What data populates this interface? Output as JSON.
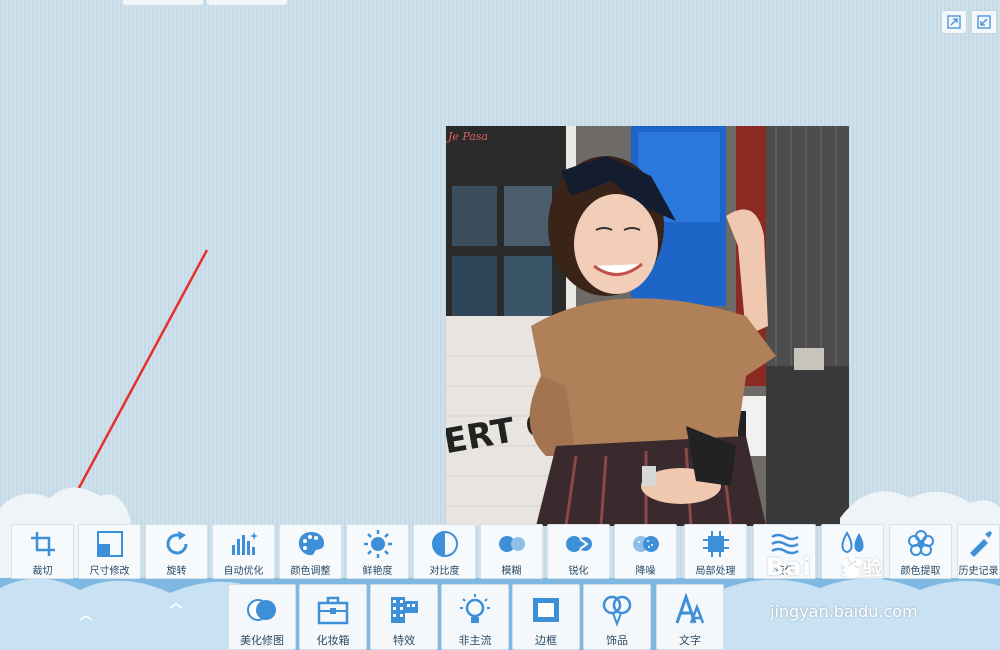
{
  "toolbar_primary": [
    {
      "label": "裁切",
      "icon": "crop-icon"
    },
    {
      "label": "尺寸修改",
      "icon": "resize-icon"
    },
    {
      "label": "旋转",
      "icon": "rotate-icon"
    },
    {
      "label": "自动优化",
      "icon": "auto-enhance-icon"
    },
    {
      "label": "颜色调整",
      "icon": "palette-icon"
    },
    {
      "label": "鲜艳度",
      "icon": "sun-icon"
    },
    {
      "label": "对比度",
      "icon": "contrast-icon"
    },
    {
      "label": "模糊",
      "icon": "blur-icon"
    },
    {
      "label": "锐化",
      "icon": "sharpen-icon"
    },
    {
      "label": "降噪",
      "icon": "denoise-icon"
    },
    {
      "label": "局部处理",
      "icon": "local-process-icon"
    },
    {
      "label": "液化",
      "icon": "liquify-icon"
    },
    {
      "label": "",
      "icon": "drops-icon"
    },
    {
      "label": "颜色提取",
      "icon": "flower-icon"
    },
    {
      "label": "历史记录",
      "icon": "history-icon"
    }
  ],
  "toolbar_secondary": [
    {
      "label": "美化修图",
      "icon": "beautify-icon"
    },
    {
      "label": "化妆箱",
      "icon": "makeup-box-icon"
    },
    {
      "label": "特效",
      "icon": "film-icon"
    },
    {
      "label": "非主流",
      "icon": "bulb-icon"
    },
    {
      "label": "边框",
      "icon": "frame-icon"
    },
    {
      "label": "饰品",
      "icon": "balloon-icon"
    },
    {
      "label": "文字",
      "icon": "text-icon"
    }
  ],
  "watermark": {
    "logo": "Bai",
    "logo_tail": "经验",
    "url": "jingyan.baidu.com"
  },
  "photo": {
    "sign_text": "ERT CULT",
    "shop_text": "Je Pasa"
  },
  "colors": {
    "accent": "#3d8fd8",
    "bg": "#cbdde8",
    "arrow": "#e8302a"
  }
}
